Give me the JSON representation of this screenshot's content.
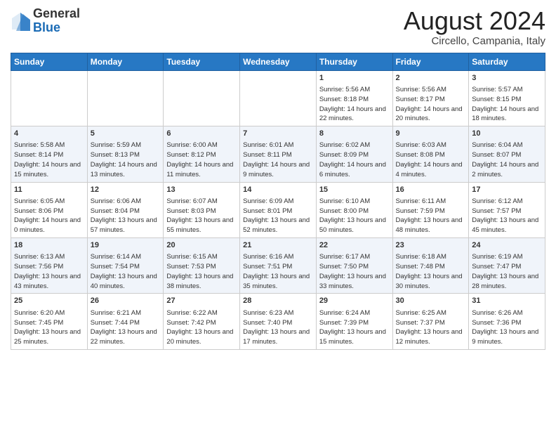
{
  "header": {
    "logo_general": "General",
    "logo_blue": "Blue",
    "month_title": "August 2024",
    "location": "Circello, Campania, Italy"
  },
  "weekdays": [
    "Sunday",
    "Monday",
    "Tuesday",
    "Wednesday",
    "Thursday",
    "Friday",
    "Saturday"
  ],
  "weeks": [
    [
      {
        "day": "",
        "info": ""
      },
      {
        "day": "",
        "info": ""
      },
      {
        "day": "",
        "info": ""
      },
      {
        "day": "",
        "info": ""
      },
      {
        "day": "1",
        "info": "Sunrise: 5:56 AM\nSunset: 8:18 PM\nDaylight: 14 hours\nand 22 minutes."
      },
      {
        "day": "2",
        "info": "Sunrise: 5:56 AM\nSunset: 8:17 PM\nDaylight: 14 hours\nand 20 minutes."
      },
      {
        "day": "3",
        "info": "Sunrise: 5:57 AM\nSunset: 8:15 PM\nDaylight: 14 hours\nand 18 minutes."
      }
    ],
    [
      {
        "day": "4",
        "info": "Sunrise: 5:58 AM\nSunset: 8:14 PM\nDaylight: 14 hours\nand 15 minutes."
      },
      {
        "day": "5",
        "info": "Sunrise: 5:59 AM\nSunset: 8:13 PM\nDaylight: 14 hours\nand 13 minutes."
      },
      {
        "day": "6",
        "info": "Sunrise: 6:00 AM\nSunset: 8:12 PM\nDaylight: 14 hours\nand 11 minutes."
      },
      {
        "day": "7",
        "info": "Sunrise: 6:01 AM\nSunset: 8:11 PM\nDaylight: 14 hours\nand 9 minutes."
      },
      {
        "day": "8",
        "info": "Sunrise: 6:02 AM\nSunset: 8:09 PM\nDaylight: 14 hours\nand 6 minutes."
      },
      {
        "day": "9",
        "info": "Sunrise: 6:03 AM\nSunset: 8:08 PM\nDaylight: 14 hours\nand 4 minutes."
      },
      {
        "day": "10",
        "info": "Sunrise: 6:04 AM\nSunset: 8:07 PM\nDaylight: 14 hours\nand 2 minutes."
      }
    ],
    [
      {
        "day": "11",
        "info": "Sunrise: 6:05 AM\nSunset: 8:06 PM\nDaylight: 14 hours\nand 0 minutes."
      },
      {
        "day": "12",
        "info": "Sunrise: 6:06 AM\nSunset: 8:04 PM\nDaylight: 13 hours\nand 57 minutes."
      },
      {
        "day": "13",
        "info": "Sunrise: 6:07 AM\nSunset: 8:03 PM\nDaylight: 13 hours\nand 55 minutes."
      },
      {
        "day": "14",
        "info": "Sunrise: 6:09 AM\nSunset: 8:01 PM\nDaylight: 13 hours\nand 52 minutes."
      },
      {
        "day": "15",
        "info": "Sunrise: 6:10 AM\nSunset: 8:00 PM\nDaylight: 13 hours\nand 50 minutes."
      },
      {
        "day": "16",
        "info": "Sunrise: 6:11 AM\nSunset: 7:59 PM\nDaylight: 13 hours\nand 48 minutes."
      },
      {
        "day": "17",
        "info": "Sunrise: 6:12 AM\nSunset: 7:57 PM\nDaylight: 13 hours\nand 45 minutes."
      }
    ],
    [
      {
        "day": "18",
        "info": "Sunrise: 6:13 AM\nSunset: 7:56 PM\nDaylight: 13 hours\nand 43 minutes."
      },
      {
        "day": "19",
        "info": "Sunrise: 6:14 AM\nSunset: 7:54 PM\nDaylight: 13 hours\nand 40 minutes."
      },
      {
        "day": "20",
        "info": "Sunrise: 6:15 AM\nSunset: 7:53 PM\nDaylight: 13 hours\nand 38 minutes."
      },
      {
        "day": "21",
        "info": "Sunrise: 6:16 AM\nSunset: 7:51 PM\nDaylight: 13 hours\nand 35 minutes."
      },
      {
        "day": "22",
        "info": "Sunrise: 6:17 AM\nSunset: 7:50 PM\nDaylight: 13 hours\nand 33 minutes."
      },
      {
        "day": "23",
        "info": "Sunrise: 6:18 AM\nSunset: 7:48 PM\nDaylight: 13 hours\nand 30 minutes."
      },
      {
        "day": "24",
        "info": "Sunrise: 6:19 AM\nSunset: 7:47 PM\nDaylight: 13 hours\nand 28 minutes."
      }
    ],
    [
      {
        "day": "25",
        "info": "Sunrise: 6:20 AM\nSunset: 7:45 PM\nDaylight: 13 hours\nand 25 minutes."
      },
      {
        "day": "26",
        "info": "Sunrise: 6:21 AM\nSunset: 7:44 PM\nDaylight: 13 hours\nand 22 minutes."
      },
      {
        "day": "27",
        "info": "Sunrise: 6:22 AM\nSunset: 7:42 PM\nDaylight: 13 hours\nand 20 minutes."
      },
      {
        "day": "28",
        "info": "Sunrise: 6:23 AM\nSunset: 7:40 PM\nDaylight: 13 hours\nand 17 minutes."
      },
      {
        "day": "29",
        "info": "Sunrise: 6:24 AM\nSunset: 7:39 PM\nDaylight: 13 hours\nand 15 minutes."
      },
      {
        "day": "30",
        "info": "Sunrise: 6:25 AM\nSunset: 7:37 PM\nDaylight: 13 hours\nand 12 minutes."
      },
      {
        "day": "31",
        "info": "Sunrise: 6:26 AM\nSunset: 7:36 PM\nDaylight: 13 hours\nand 9 minutes."
      }
    ]
  ]
}
